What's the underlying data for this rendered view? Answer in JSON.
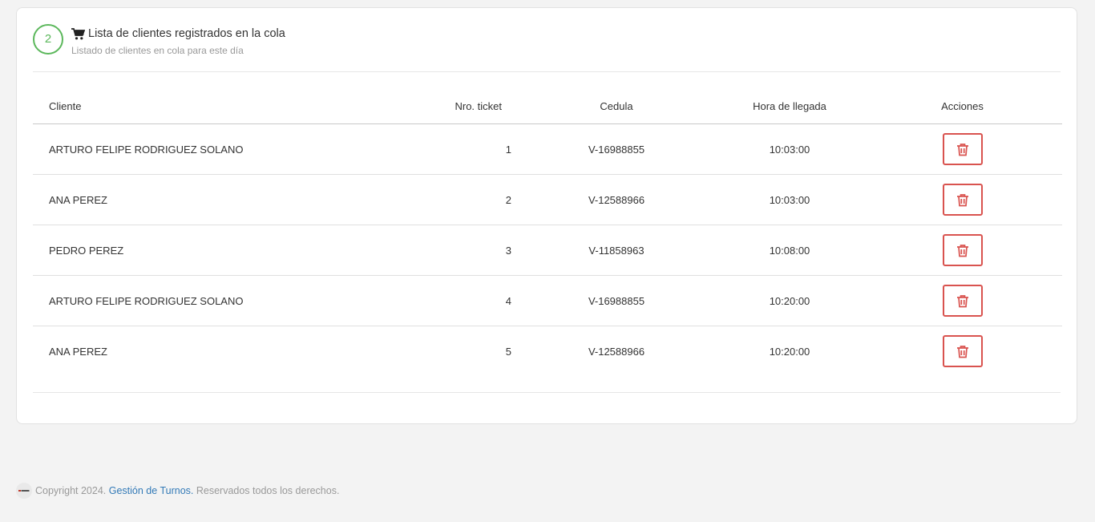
{
  "panel": {
    "step": "2",
    "title": "Lista de clientes registrados en la cola",
    "subtitle": "Listado de clientes en cola para este día",
    "title_icon": "shopping-cart-icon"
  },
  "table": {
    "headers": {
      "cliente": "Cliente",
      "ticket": "Nro. ticket",
      "cedula": "Cedula",
      "hora": "Hora de llegada",
      "acciones": "Acciones"
    },
    "action_icon": "trash-icon",
    "rows": [
      {
        "cliente": "ARTURO FELIPE RODRIGUEZ SOLANO",
        "ticket": "1",
        "cedula": "V-16988855",
        "hora": "10:03:00"
      },
      {
        "cliente": "ANA PEREZ",
        "ticket": "2",
        "cedula": "V-12588966",
        "hora": "10:03:00"
      },
      {
        "cliente": "PEDRO PEREZ",
        "ticket": "3",
        "cedula": "V-11858963",
        "hora": "10:08:00"
      },
      {
        "cliente": "ARTURO FELIPE RODRIGUEZ SOLANO",
        "ticket": "4",
        "cedula": "V-16988855",
        "hora": "10:20:00"
      },
      {
        "cliente": "ANA PEREZ",
        "ticket": "5",
        "cedula": "V-12588966",
        "hora": "10:20:00"
      }
    ]
  },
  "footer": {
    "prefix": "Copyright 2024.",
    "brand": "Gestión de Turnos.",
    "suffix": "Reservados todos los derechos."
  },
  "colors": {
    "step_green": "#5cb85c",
    "danger_red": "#d9534f",
    "link_blue": "#337ab7"
  }
}
